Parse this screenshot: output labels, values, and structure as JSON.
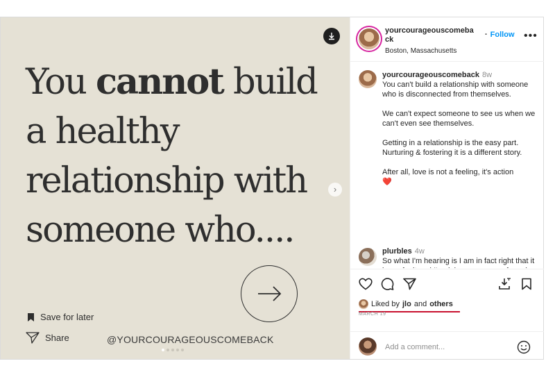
{
  "post": {
    "quote_part1": "You ",
    "quote_bold": "cannot",
    "quote_part2": " build a healthy relationship with someone who....",
    "save_label": "Save for later",
    "share_label": "Share",
    "handle_text": "@YOURCOURAGEOUSCOMEBACK"
  },
  "header": {
    "username": "yourcourageouscomebа ck",
    "follow_label": "Follow",
    "follow_sep": "·",
    "location": "Boston, Massachusetts",
    "more_label": "•••"
  },
  "comments": [
    {
      "username": "yourcourageouscomeback",
      "time": "8w",
      "paragraphs": [
        "You can't build a relationship with someone who is disconnected from themselves.",
        "We can't expect someone to see us when we can't even see themselves.",
        "Getting in a relationship is the easy part. Nurturing & fostering it is a different story.",
        "After all, love is not a feeling, it's action"
      ],
      "emoji": "❤️"
    },
    {
      "username": "plurbles",
      "time": "4w",
      "text": "So what I'm hearing is I am in fact right that it is my fault and I'm doing everyone a favor by avoiding"
    }
  ],
  "actions": {
    "liked_prefix": "Liked by ",
    "liked_user": "jlo",
    "liked_mid": " and ",
    "liked_others": "others",
    "date": "MARCH 19",
    "add_comment_placeholder": "Add a comment..."
  },
  "colors": {
    "image_bg": "#e5e1d5",
    "follow": "#0095f6",
    "underline": "#c8102e"
  }
}
